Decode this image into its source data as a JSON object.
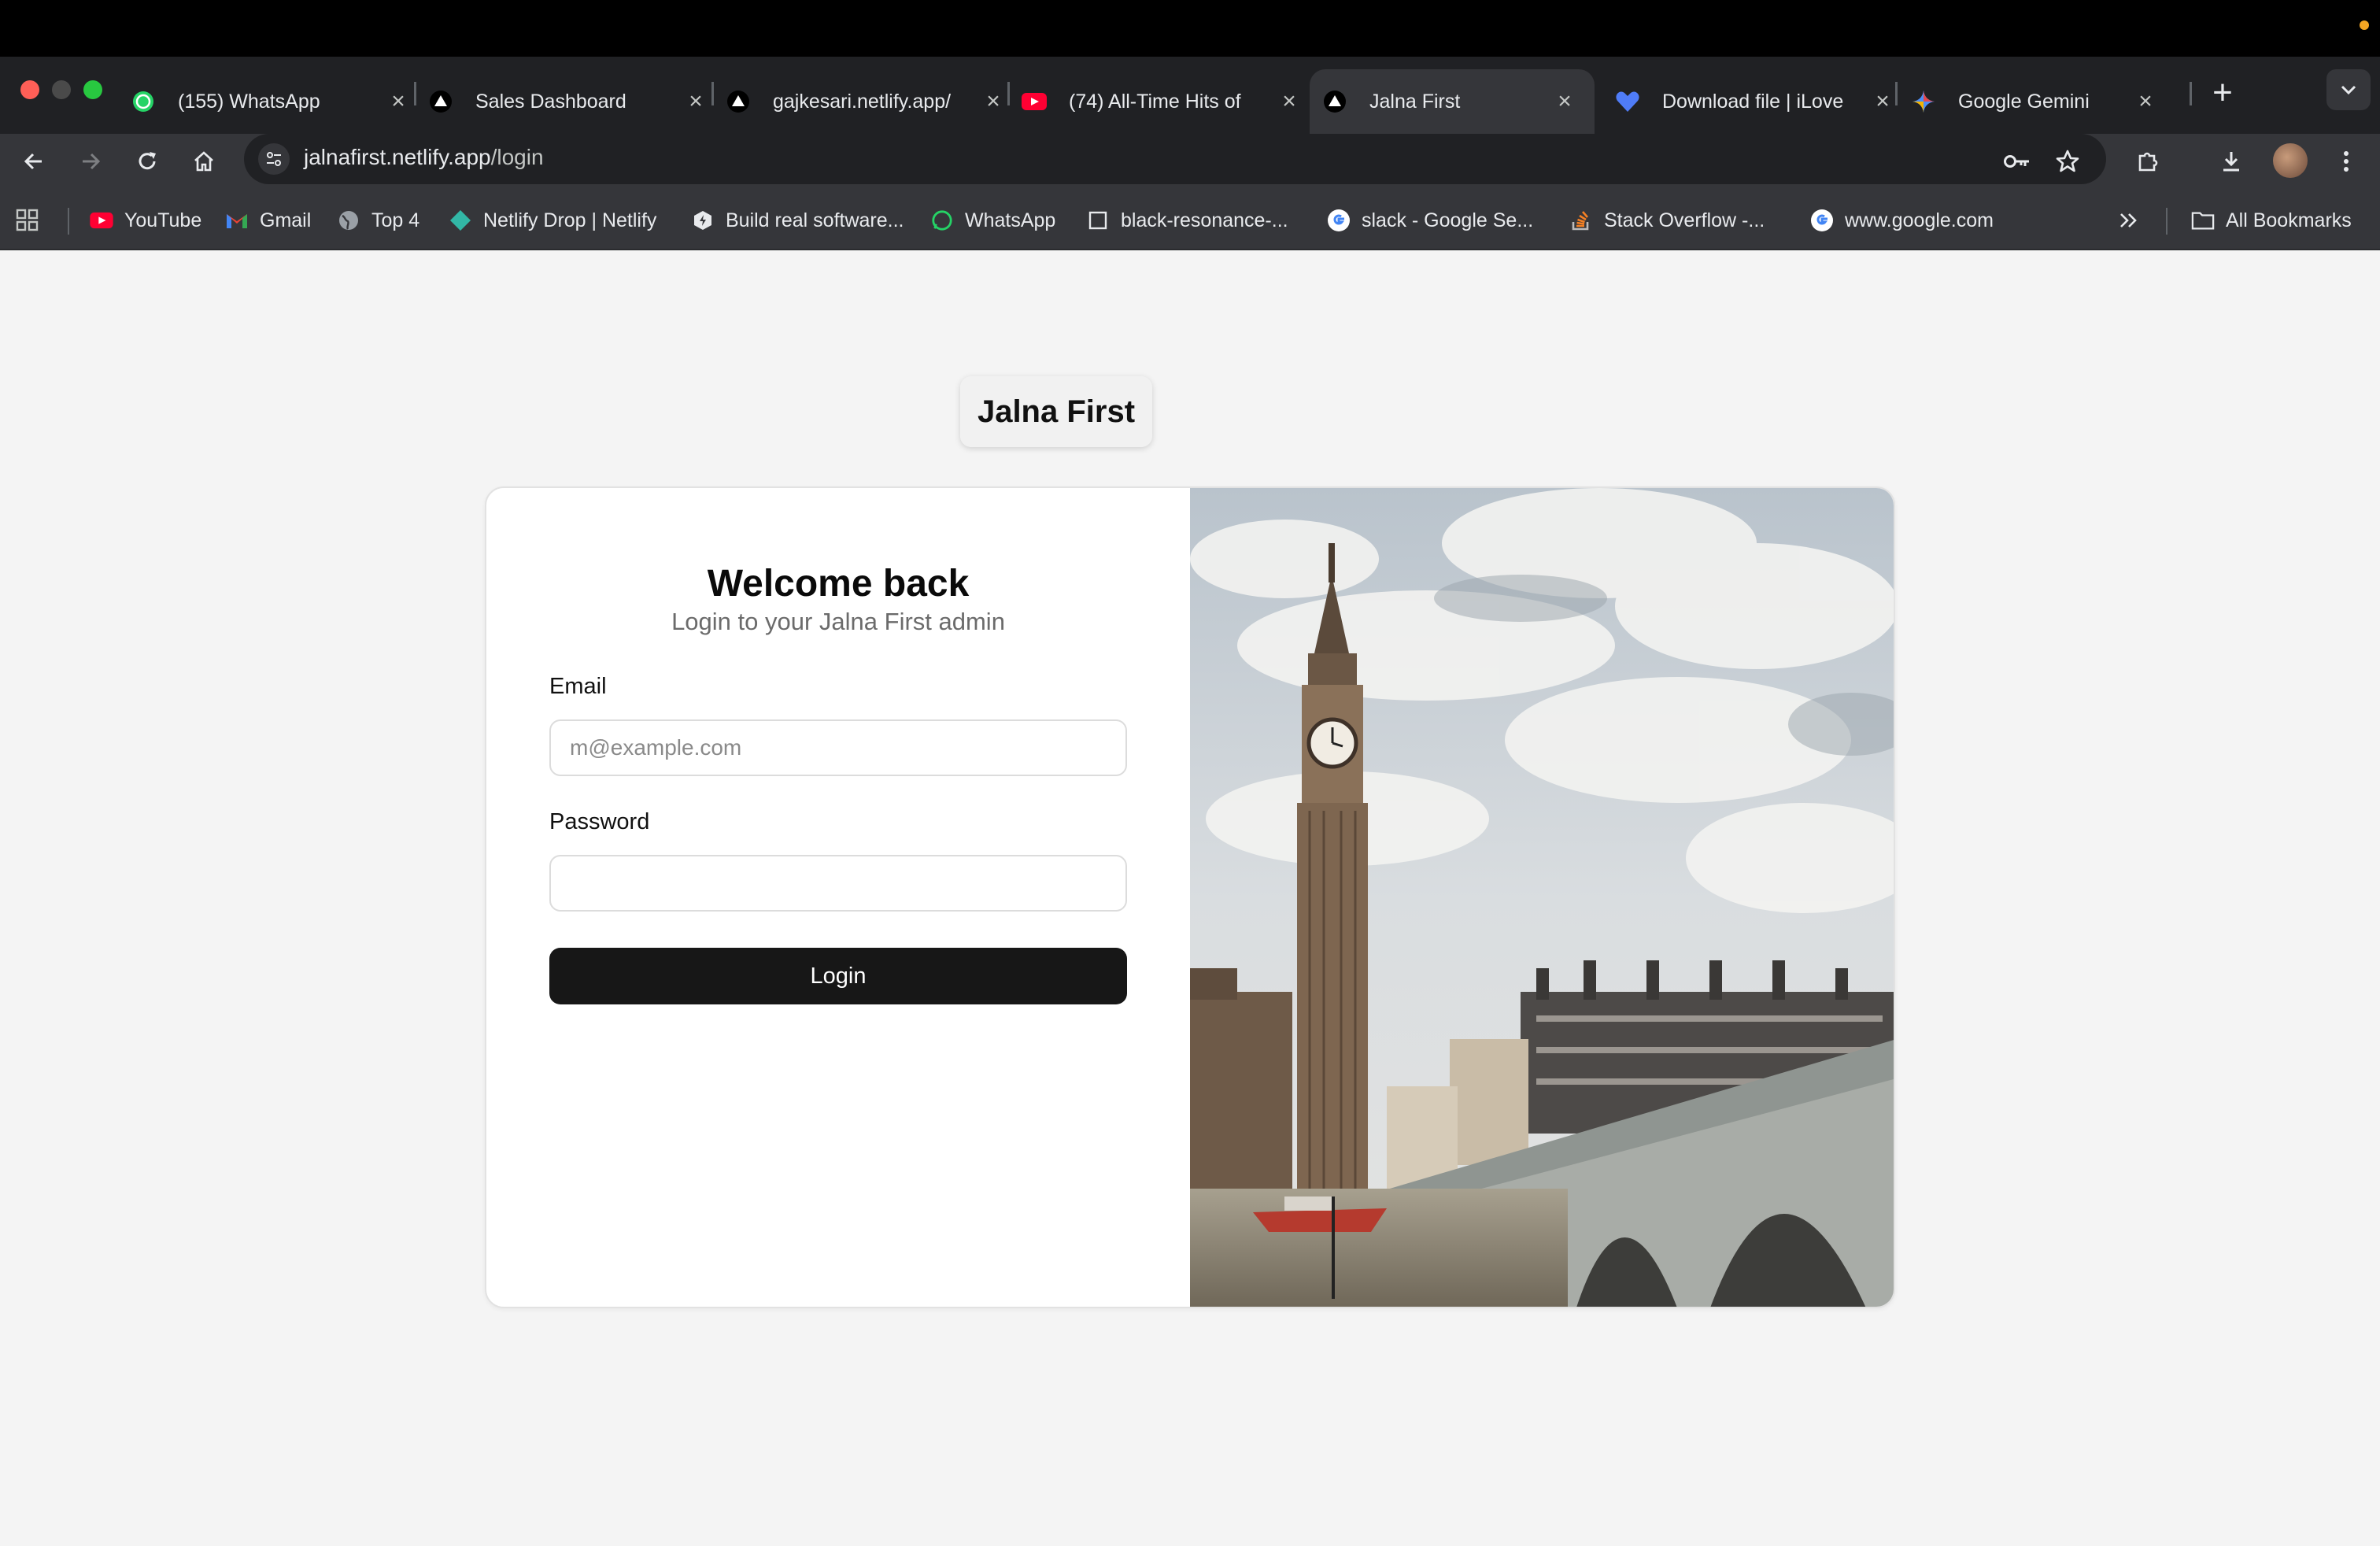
{
  "browser": {
    "tabs": [
      {
        "title": "(155) WhatsApp",
        "icon": "whatsapp-icon",
        "active": false
      },
      {
        "title": "Sales Dashboard",
        "icon": "vercel-icon",
        "active": false
      },
      {
        "title": "gajkesari.netlify.app/",
        "icon": "vercel-icon",
        "active": false
      },
      {
        "title": "(74) All-Time Hits of",
        "icon": "youtube-icon",
        "active": false
      },
      {
        "title": "Jalna First",
        "icon": "vercel-icon",
        "active": true
      },
      {
        "title": "Download file | iLove",
        "icon": "ilovepdf-heart-icon",
        "active": false
      },
      {
        "title": "Google Gemini",
        "icon": "gemini-icon",
        "active": false
      }
    ],
    "url_host": "jalnafirst.netlify.app",
    "url_path": "/login",
    "bookmarks": [
      {
        "label": "YouTube",
        "icon": "youtube-icon"
      },
      {
        "label": "Gmail",
        "icon": "gmail-icon"
      },
      {
        "label": "Top 4",
        "icon": "globe-icon"
      },
      {
        "label": "Netlify Drop | Netlify",
        "icon": "netlify-icon"
      },
      {
        "label": "Build real software...",
        "icon": "bolt-icon"
      },
      {
        "label": "WhatsApp",
        "icon": "whatsapp-icon"
      },
      {
        "label": "black-resonance-...",
        "icon": "square-icon"
      },
      {
        "label": "slack - Google Se...",
        "icon": "google-icon"
      },
      {
        "label": "Stack Overflow -...",
        "icon": "stackoverflow-icon"
      },
      {
        "label": "www.google.com",
        "icon": "google-icon"
      }
    ],
    "all_bookmarks": "All Bookmarks"
  },
  "login": {
    "title": "Welcome back",
    "subtitle": "Login to your Jalna First admin",
    "email_label": "Email",
    "email_placeholder": "m@example.com",
    "password_label": "Password",
    "password_value": "",
    "button_label": "Login"
  },
  "hero": {
    "brand": "Jalna First"
  },
  "colors": {
    "page_bg": "#f4f4f4",
    "button_bg": "#171717",
    "chrome_dark": "#202124",
    "chrome_toolbar": "#35363a"
  }
}
